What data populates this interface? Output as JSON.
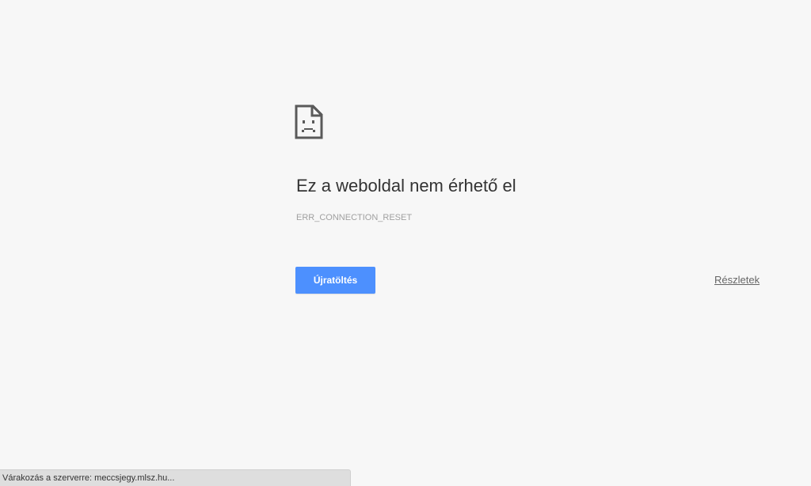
{
  "error_page": {
    "icon": "sad-page-icon",
    "headline": "Ez a weboldal nem érhető el",
    "error_code": "ERR_CONNECTION_RESET",
    "reload_label": "Újratöltés",
    "details_label": "Részletek"
  },
  "status_bar": {
    "text": "Várakozás a szerverre: meccsjegy.mlsz.hu..."
  },
  "colors": {
    "background": "#f7f7f7",
    "button": "#4d90fe",
    "headline": "#333333",
    "error_code": "#a0a0a0"
  }
}
